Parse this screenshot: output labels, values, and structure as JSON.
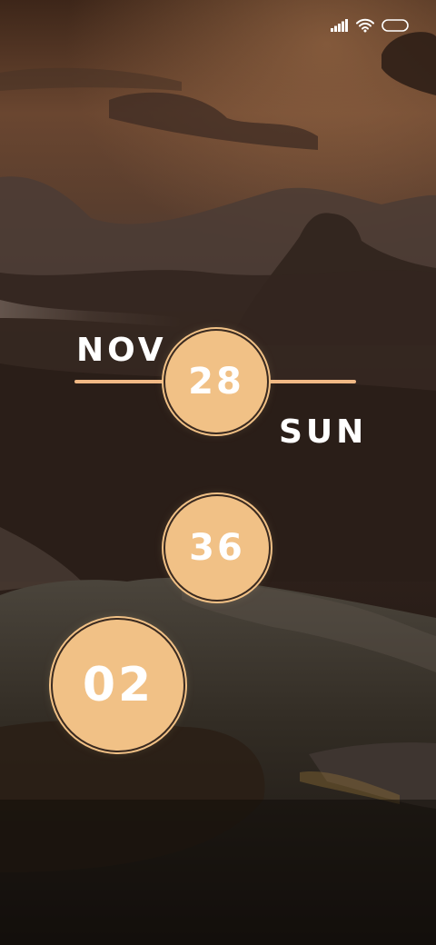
{
  "lockscreen": {
    "month": "NOV",
    "day": "28",
    "weekday": "SUN",
    "minute": "36",
    "hour": "02"
  },
  "status_bar": {
    "icons": [
      "signal-icon",
      "wifi-icon",
      "battery-icon"
    ]
  },
  "colors": {
    "accent": "#f1c186",
    "line": "#f1b985",
    "text": "#ffffff"
  }
}
